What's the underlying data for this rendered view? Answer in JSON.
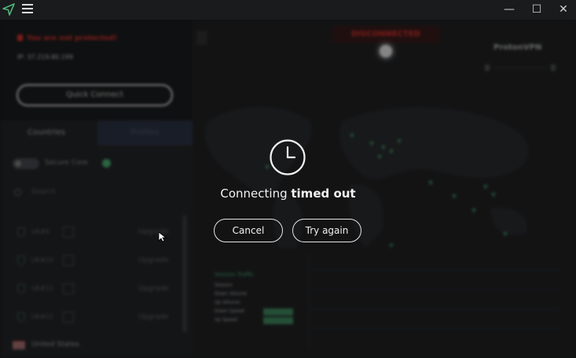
{
  "window": {
    "logo_icon": "protonvpn-logo-icon",
    "menu_icon": "hamburger-menu-icon",
    "minimize": "—",
    "maximize": "☐",
    "close": "✕"
  },
  "sidebar": {
    "warning": "You are not protected!",
    "ip": "IP: 37.219.80.199",
    "quick_connect": "Quick Connect",
    "tabs": [
      "Countries",
      "Profiles"
    ],
    "secure_core_toggle": "off",
    "secure_core_label": "Secure Core",
    "search_placeholder": "Search",
    "servers": [
      {
        "name": "UK#9",
        "action": "Upgrade"
      },
      {
        "name": "UK#10",
        "action": "Upgrade"
      },
      {
        "name": "UK#11",
        "action": "Upgrade"
      },
      {
        "name": "UK#12",
        "action": "Upgrade"
      }
    ],
    "bottom_country": "United States"
  },
  "map": {
    "status": "DISCONNECTED",
    "brand": "ProtonVPN",
    "traffic": {
      "title": "Session Traffic",
      "rows": [
        "Session",
        "Down Volume",
        "Up Volume",
        "Down Speed",
        "Up Speed"
      ]
    }
  },
  "dialog": {
    "icon": "clock-icon",
    "message_prefix": "Connecting ",
    "message_emphasis": "timed out",
    "cancel_label": "Cancel",
    "retry_label": "Try again"
  },
  "colors": {
    "accent_green": "#4fb47a",
    "danger_red": "#e3342f",
    "background": "#1b1c1e"
  }
}
